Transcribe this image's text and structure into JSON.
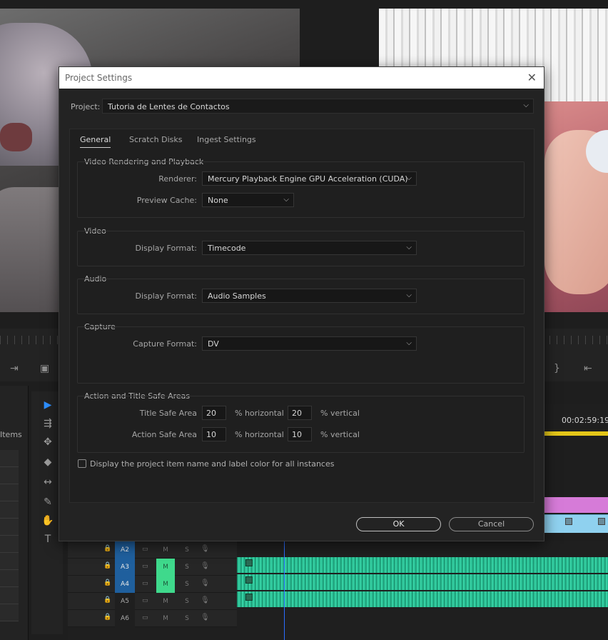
{
  "dialog": {
    "title": "Project Settings",
    "close_glyph": "✕",
    "project_label": "Project:",
    "project_value": "Tutoria de Lentes de Contactos",
    "tabs": [
      {
        "label": "General"
      },
      {
        "label": "Scratch Disks"
      },
      {
        "label": "Ingest Settings"
      }
    ],
    "video_rendering": {
      "title": "Video Rendering and Playback",
      "renderer_label": "Renderer:",
      "renderer_value": "Mercury Playback Engine GPU Acceleration (CUDA)",
      "preview_cache_label": "Preview Cache:",
      "preview_cache_value": "None"
    },
    "video": {
      "title": "Video",
      "display_format_label": "Display Format:",
      "display_format_value": "Timecode"
    },
    "audio": {
      "title": "Audio",
      "display_format_label": "Display Format:",
      "display_format_value": "Audio Samples"
    },
    "capture": {
      "title": "Capture",
      "capture_format_label": "Capture Format:",
      "capture_format_value": "DV"
    },
    "safe_areas": {
      "title": "Action and Title Safe Areas",
      "title_safe_label": "Title Safe Area",
      "title_safe_h": "20",
      "title_safe_v": "20",
      "action_safe_label": "Action Safe Area",
      "action_safe_h": "10",
      "action_safe_v": "10",
      "horizontal_unit": "% horizontal",
      "vertical_unit": "% vertical"
    },
    "display_item_name_label": "Display the project item name and label color for all instances",
    "display_item_name_checked": false,
    "ok_label": "OK",
    "cancel_label": "Cancel"
  },
  "background": {
    "items_label": "Items",
    "timecode": "00:02:59:19",
    "tracks": [
      {
        "name": "A2",
        "m_on": false
      },
      {
        "name": "A3",
        "m_on": true
      },
      {
        "name": "A4",
        "m_on": true
      },
      {
        "name": "A5",
        "m_on": false
      },
      {
        "name": "A6",
        "m_on": false
      }
    ],
    "track_m": "M",
    "track_s": "S"
  },
  "colors": {
    "accent_blue": "#2e8fff",
    "track_target": "#1f5f9d",
    "mute_green": "#3fd98c",
    "audio_clip": "#3fe0b0",
    "pink_clip": "#d67bd8",
    "blue_clip": "#8fd1ef"
  }
}
